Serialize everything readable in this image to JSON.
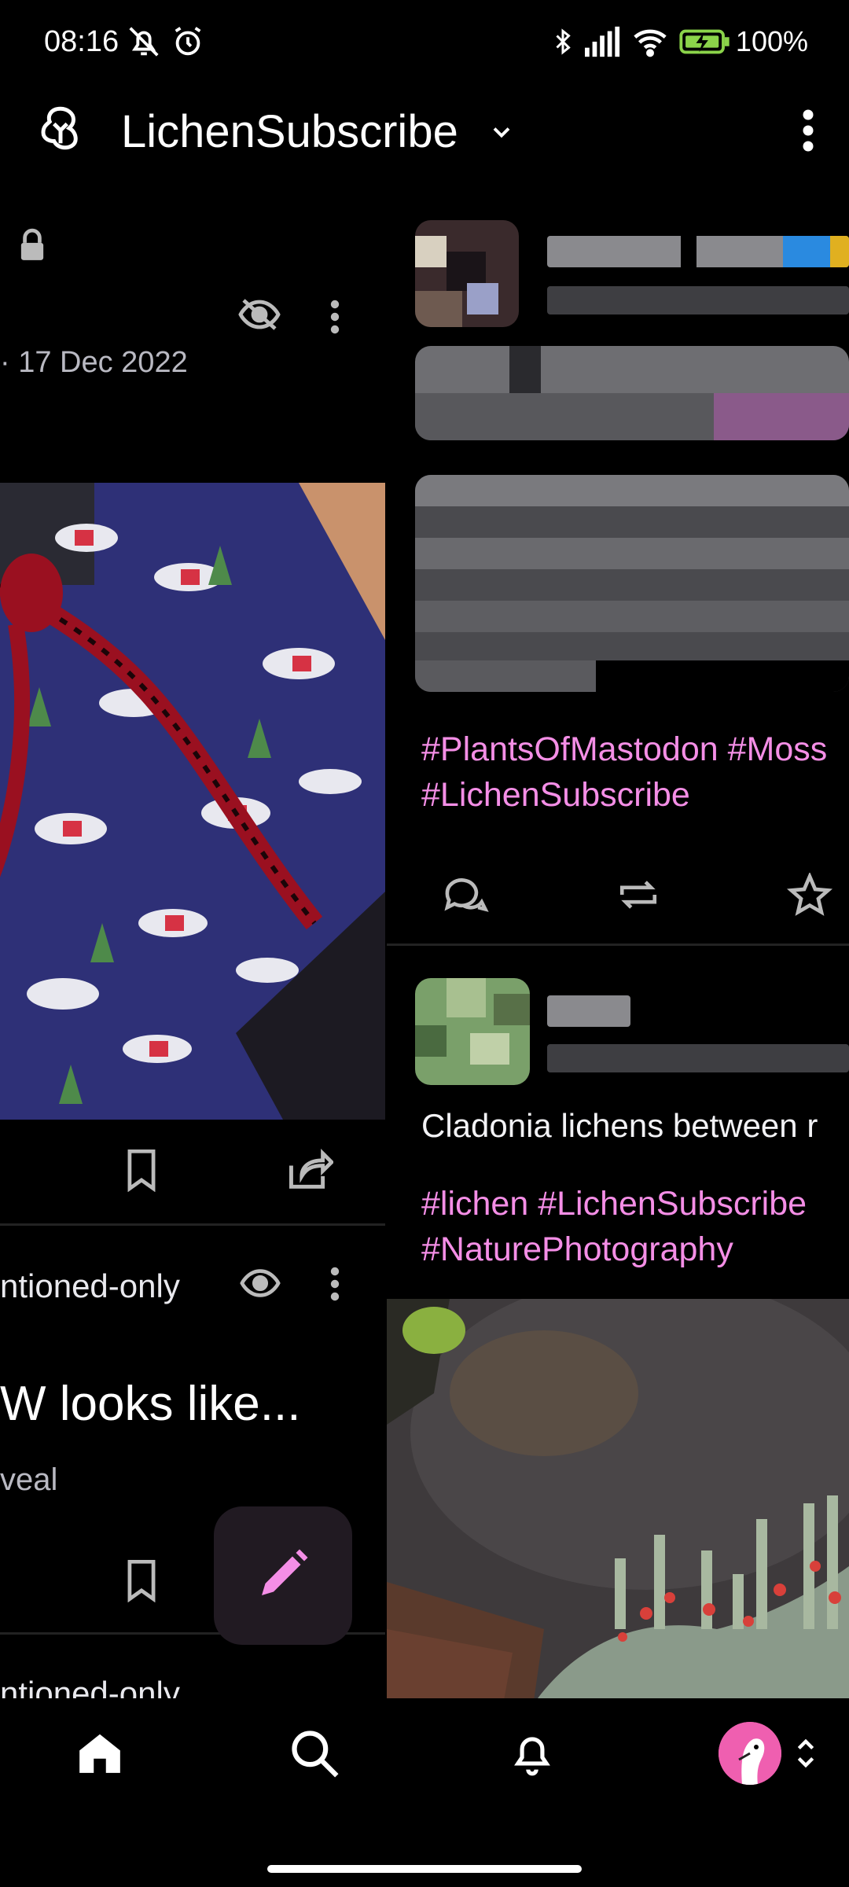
{
  "status_bar": {
    "time": "08:16",
    "battery": "100%"
  },
  "app_bar": {
    "title": "LichenSubscribe"
  },
  "left_column": {
    "date": "· 17 Dec 2022",
    "mentioned_label_1": "ntioned-only",
    "cw_title": "W looks like...",
    "cw_subtitle": "veal",
    "mentioned_label_2": "ntioned-only"
  },
  "right_column": {
    "post1_hashtags_line1": "#PlantsOfMastodon #Moss",
    "post1_hashtags_line2": "#LichenSubscribe",
    "post2_text": "Cladonia lichens between r",
    "post2_hashtags_line1": "#lichen #LichenSubscribe",
    "post2_hashtags_line2": "#NaturePhotography"
  },
  "colors": {
    "accent": "#f48ee6",
    "background": "#000000"
  },
  "icons": {
    "bottom_nav": [
      "home-icon",
      "search-icon",
      "bell-icon",
      "avatar"
    ]
  }
}
